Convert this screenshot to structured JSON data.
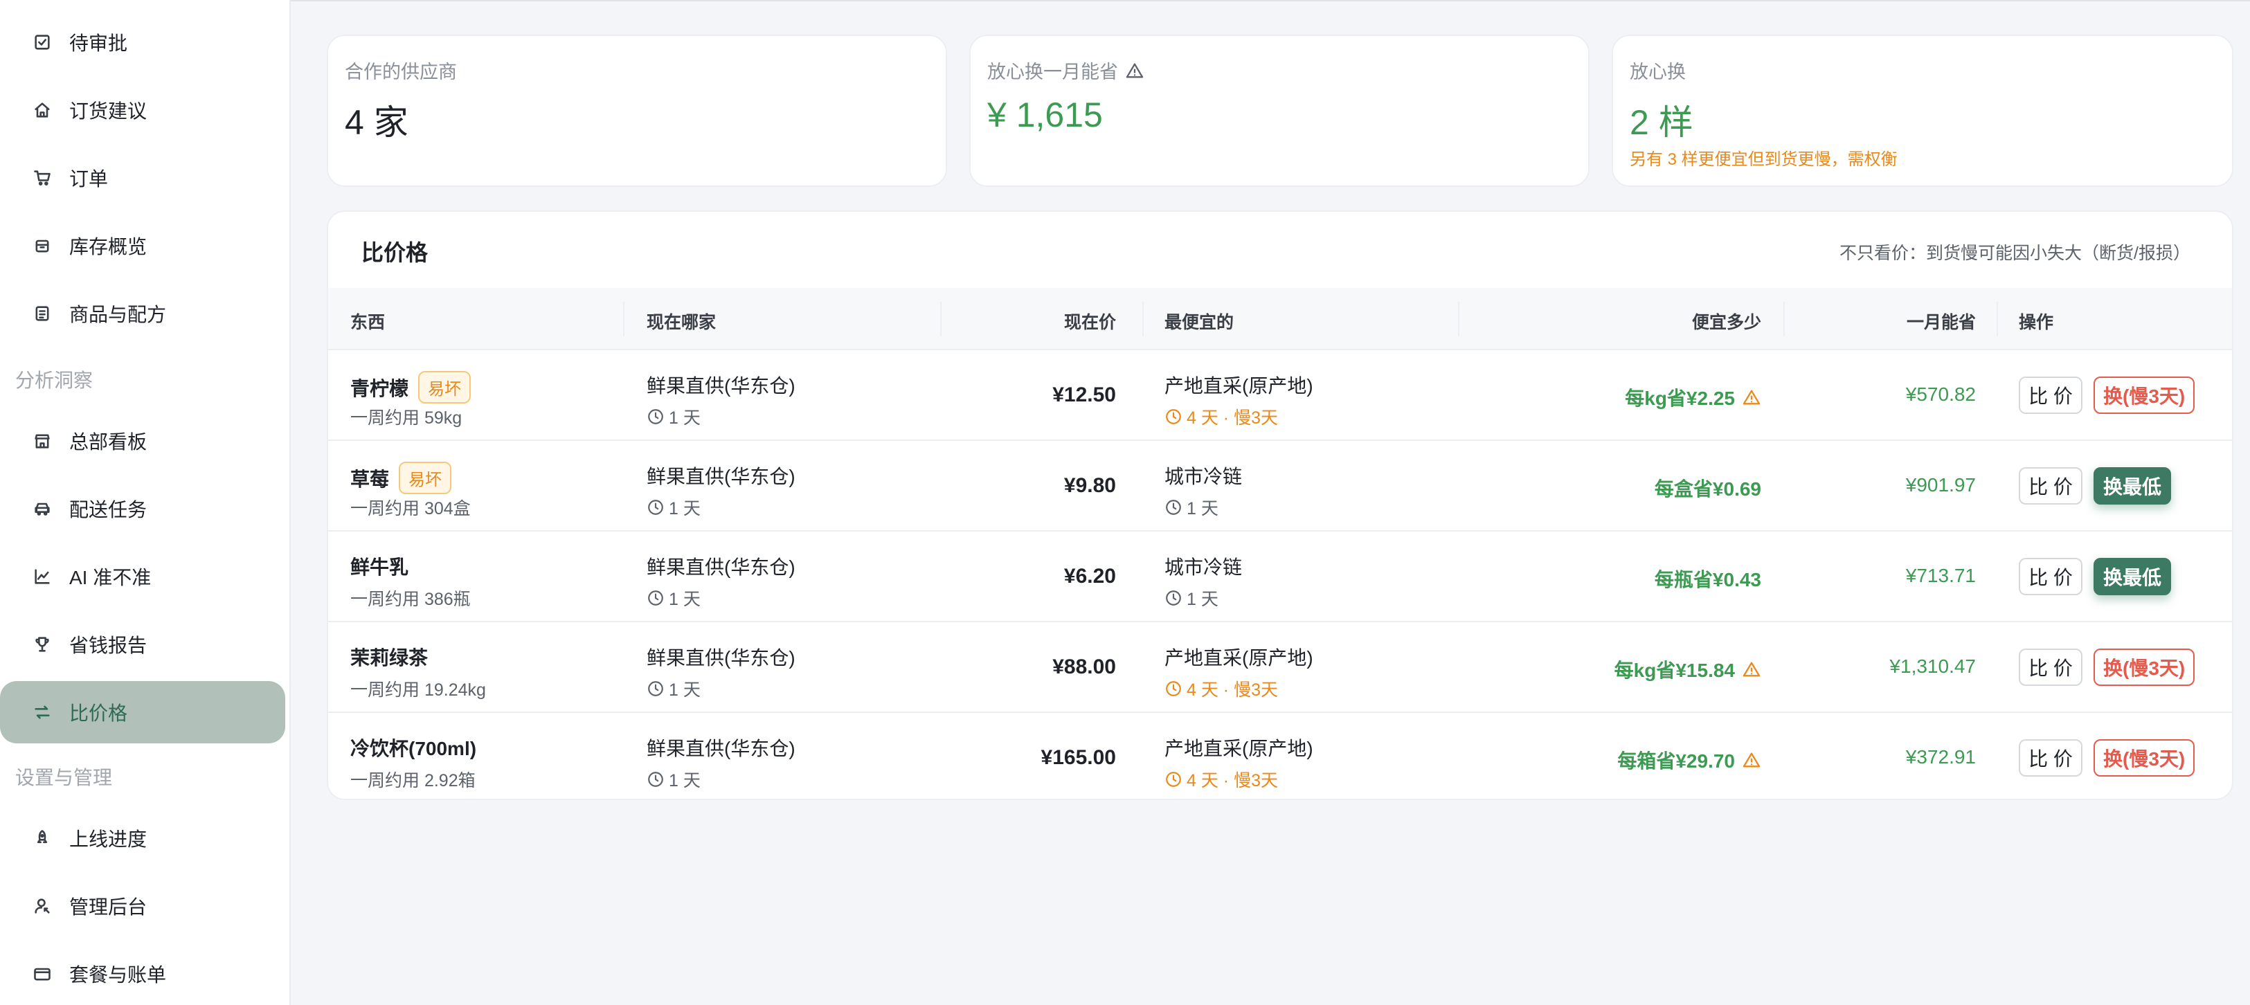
{
  "sidebar": {
    "items_top": [
      {
        "label": "待审批",
        "icon": "checkbox-icon"
      },
      {
        "label": "订货建议",
        "icon": "home-icon"
      },
      {
        "label": "订单",
        "icon": "cart-icon"
      },
      {
        "label": "库存概览",
        "icon": "box-icon"
      },
      {
        "label": "商品与配方",
        "icon": "list-icon"
      }
    ],
    "section_analysis": "分析洞察",
    "items_analysis": [
      {
        "label": "总部看板",
        "icon": "store-icon"
      },
      {
        "label": "配送任务",
        "icon": "car-icon"
      },
      {
        "label": "AI 准不准",
        "icon": "chart-icon"
      },
      {
        "label": "省钱报告",
        "icon": "trophy-icon"
      },
      {
        "label": "比价格",
        "icon": "swap-icon",
        "active": true
      }
    ],
    "section_settings": "设置与管理",
    "items_settings": [
      {
        "label": "上线进度",
        "icon": "rocket-icon"
      },
      {
        "label": "管理后台",
        "icon": "admin-icon"
      },
      {
        "label": "套餐与账单",
        "icon": "card-icon"
      }
    ]
  },
  "cards": {
    "suppliers": {
      "label": "合作的供应商",
      "value": "4 家"
    },
    "monthly_save": {
      "label": "放心换一月能省",
      "value": "¥ 1,615"
    },
    "safe_switch": {
      "label": "放心换",
      "value": "2 样",
      "note": "另有 3 样更便宜但到货更慢，需权衡"
    }
  },
  "panel": {
    "title": "比价格",
    "hint": "不只看价：到货慢可能因小失大（断货/报损）",
    "headers": {
      "item": "东西",
      "current_supplier": "现在哪家",
      "current_price": "现在价",
      "cheapest": "最便宜的",
      "saving": "便宜多少",
      "monthly": "一月能省",
      "action": "操作"
    },
    "compare_label": "比 价",
    "rows": [
      {
        "name": "青柠檬",
        "tag": "易坏",
        "usage": "一周约用 59kg",
        "supplier": "鲜果直供(华东仓)",
        "supplier_lead": "1 天",
        "price": "¥12.50",
        "cheapest": "产地直采(原产地)",
        "cheapest_lead": "4 天 · 慢3天",
        "slow": true,
        "saving": "每kg省¥2.25",
        "monthly": "¥570.82",
        "switch": "换(慢3天)"
      },
      {
        "name": "草莓",
        "tag": "易坏",
        "usage": "一周约用 304盒",
        "supplier": "鲜果直供(华东仓)",
        "supplier_lead": "1 天",
        "price": "¥9.80",
        "cheapest": "城市冷链",
        "cheapest_lead": "1 天",
        "slow": false,
        "saving": "每盒省¥0.69",
        "monthly": "¥901.97",
        "switch": "换最低"
      },
      {
        "name": "鲜牛乳",
        "tag": "",
        "usage": "一周约用 386瓶",
        "supplier": "鲜果直供(华东仓)",
        "supplier_lead": "1 天",
        "price": "¥6.20",
        "cheapest": "城市冷链",
        "cheapest_lead": "1 天",
        "slow": false,
        "saving": "每瓶省¥0.43",
        "monthly": "¥713.71",
        "switch": "换最低"
      },
      {
        "name": "茉莉绿茶",
        "tag": "",
        "usage": "一周约用 19.24kg",
        "supplier": "鲜果直供(华东仓)",
        "supplier_lead": "1 天",
        "price": "¥88.00",
        "cheapest": "产地直采(原产地)",
        "cheapest_lead": "4 天 · 慢3天",
        "slow": true,
        "saving": "每kg省¥15.84",
        "monthly": "¥1,310.47",
        "switch": "换(慢3天)"
      },
      {
        "name": "冷饮杯(700ml)",
        "tag": "",
        "usage": "一周约用 2.92箱",
        "supplier": "鲜果直供(华东仓)",
        "supplier_lead": "1 天",
        "price": "¥165.00",
        "cheapest": "产地直采(原产地)",
        "cheapest_lead": "4 天 · 慢3天",
        "slow": true,
        "saving": "每箱省¥29.70",
        "monthly": "¥372.91",
        "switch": "换(慢3天)"
      }
    ]
  }
}
